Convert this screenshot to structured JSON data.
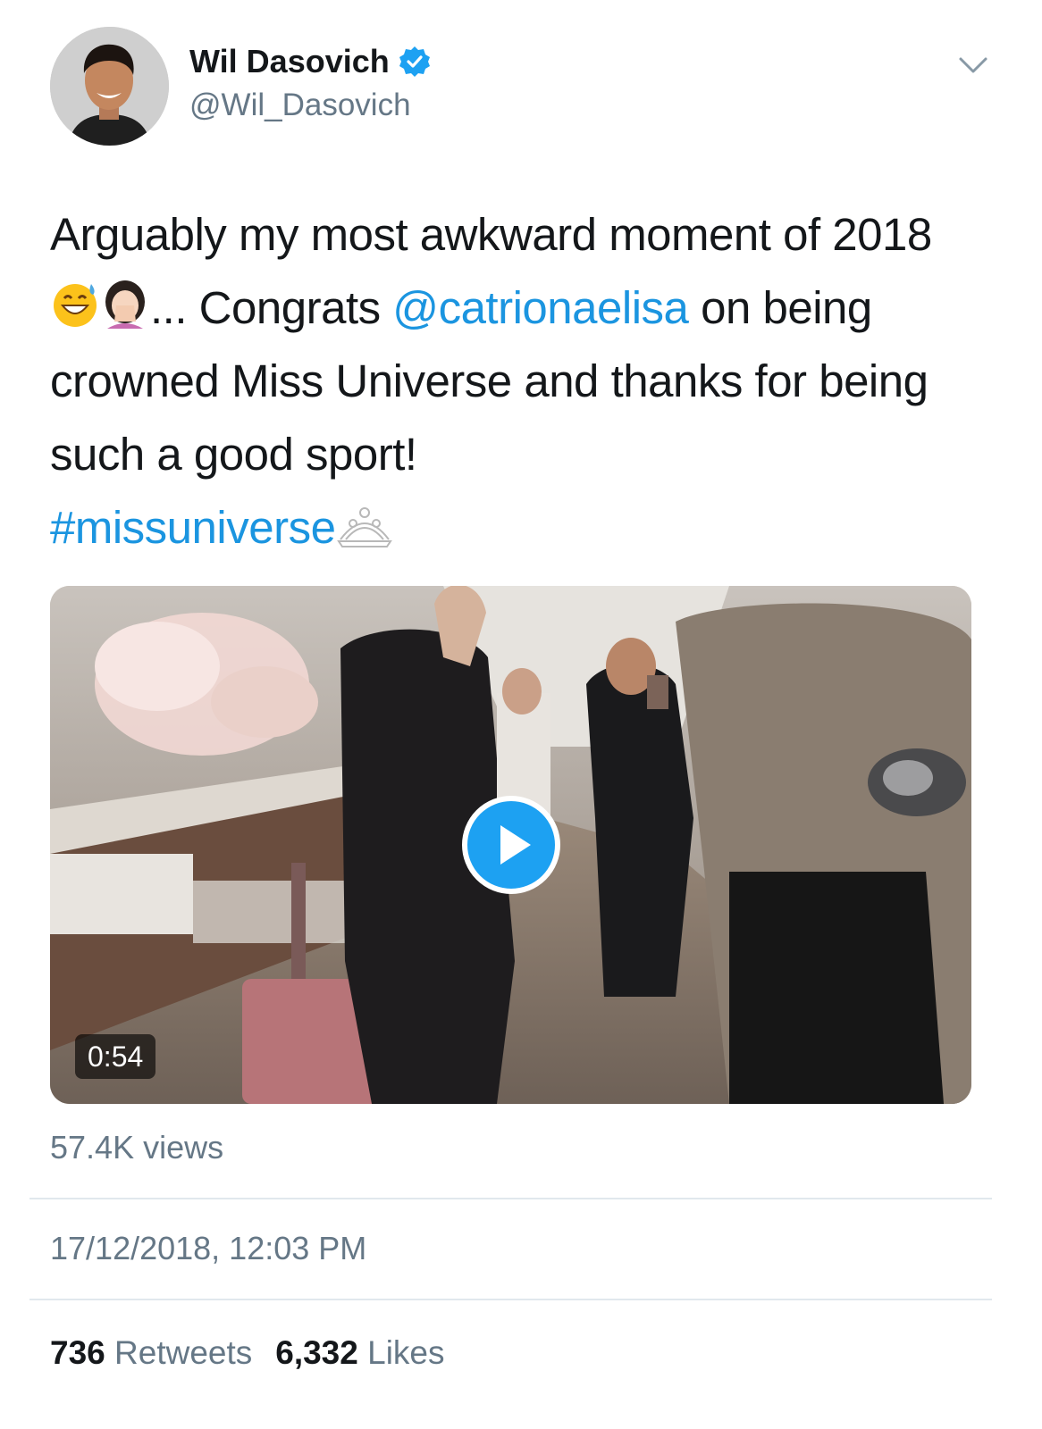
{
  "author": {
    "display_name": "Wil Dasovich",
    "handle": "@Wil_Dasovich",
    "verified": true,
    "avatar_icon": "profile-photo",
    "menu_icon": "chevron-down-icon"
  },
  "tweet": {
    "text_part1": "Arguably my most awkward moment of 2018",
    "emoji1": "grinning-sweat-emoji",
    "emoji2": "facepalm-emoji",
    "text_part2": "... Congrats ",
    "mention": "@catrionaelisa",
    "text_part3": " on being crowned Miss Universe and thanks for being such  a good sport!",
    "hashtag": "#missuniverse",
    "emoji3": "tiara-emoji"
  },
  "media": {
    "type": "video",
    "duration": "0:54",
    "play_icon": "play-icon"
  },
  "views": "57.4K views",
  "timestamp": "17/12/2018, 12:03 PM",
  "stats": {
    "retweets_count": "736",
    "retweets_label": "Retweets",
    "likes_count": "6,332",
    "likes_label": "Likes"
  },
  "colors": {
    "link": "#1b95e0",
    "secondary_text": "#657786",
    "divider": "#e1e8ed",
    "verified": "#1da1f2"
  }
}
